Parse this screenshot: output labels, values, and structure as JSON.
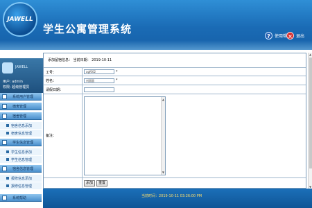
{
  "header": {
    "logo_text": "JAWELL",
    "app_title": "学生公寓管理系统",
    "help_label": "使用帮助",
    "logout_label": "退出",
    "help_icon": "question-icon",
    "logout_icon": "close-icon",
    "colors": {
      "bar": "#1a6bb5",
      "accent": "#2f8fd6",
      "clock": "#ffdf6b"
    }
  },
  "sidebar": {
    "brand": "JAWELL",
    "user_line1": "用户: admin",
    "user_line2": "权限: 超级管理员",
    "groups": [
      {
        "label": "系统用户管理"
      },
      {
        "label": "宿舍管理"
      },
      {
        "label": "宿舍管理"
      },
      {
        "label": "学生信息管理"
      },
      {
        "label": "宿舍信息管理"
      },
      {
        "label": "系统帮助"
      }
    ],
    "subs": [
      {
        "label": "宿舍信息添加"
      },
      {
        "label": "宿舍信息管理"
      },
      {
        "label": "学生信息添加"
      },
      {
        "label": "学生信息管理"
      },
      {
        "label": "报修信息添加"
      },
      {
        "label": "报修信息管理"
      }
    ]
  },
  "form": {
    "section_title": "添加留宿信息：   当前日期：  2019-10-11",
    "rows": [
      {
        "label": "工号：",
        "value": "agf002",
        "marker": "*"
      },
      {
        "label": "姓名：",
        "value": "刘丽丽",
        "marker": "*"
      },
      {
        "label": "请假日期：",
        "value": "",
        "marker": ""
      }
    ],
    "remark_label": "备注：",
    "remark_value": "",
    "submit_label": "添加",
    "reset_label": "重置"
  },
  "status": {
    "clock": "当前时间：2019-10-11 03:26:00 PM"
  }
}
